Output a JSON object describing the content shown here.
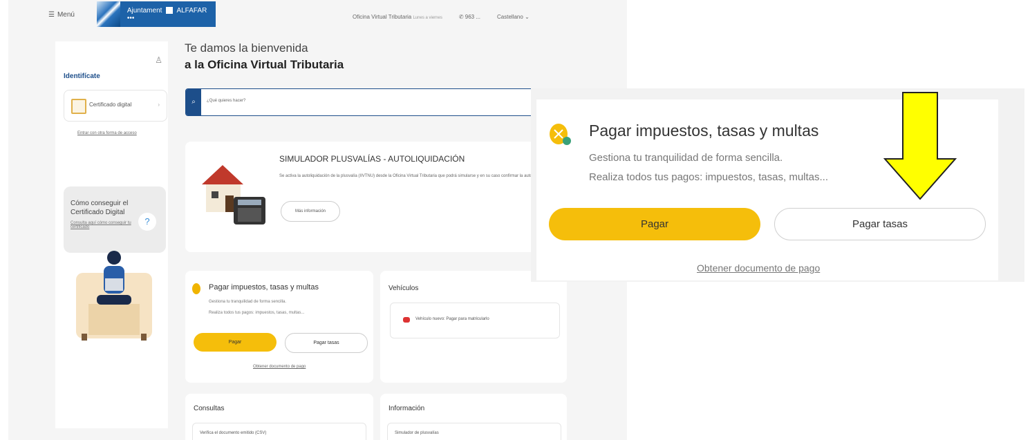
{
  "header": {
    "menu_label": "Menú",
    "brand_name": "Ajuntament",
    "brand_town": "ALFAFAR",
    "brand_dots": "•••",
    "office": "Oficina Virtual Tributaria",
    "hours": "Lunes a viernes",
    "phone": "963 ...",
    "language": "Castellano"
  },
  "sidebar": {
    "identify_title": "Identifícate",
    "cert_label": "Certificado digital",
    "other_access": "Entrar con otra forma de acceso",
    "howto_title": "Cómo conseguir el Certificado Digital",
    "howto_link": "Consulta aquí cómo conseguir tu certificado",
    "help_glyph": "?"
  },
  "welcome": {
    "line1": "Te damos la bienvenida",
    "line2": "a la Oficina Virtual Tributaria"
  },
  "search": {
    "placeholder": "¿Qué quieres hacer?"
  },
  "simulator": {
    "title": "SIMULADOR PLUSVALÍAS - AUTOLIQUIDACIÓN",
    "text": "Se activa la autoliquidación de la plusvalía (IIVTNU) desde la Oficina Virtual Tributaria que podrá simularse y en su caso confirmar la autoliquidación.",
    "button": "Más información"
  },
  "pay_card": {
    "title": "Pagar impuestos, tasas y multas",
    "sub1": "Gestiona tu tranquilidad de forma sencilla.",
    "sub2": "Realiza todos tus pagos: impuestos, tasas, multas...",
    "pay": "Pagar",
    "pay_fees": "Pagar tasas",
    "doc_link": "Obtener documento de pago"
  },
  "vehicles": {
    "title": "Vehículos",
    "item": "Vehículo nuevo: Pagar para matricularlo"
  },
  "queries": {
    "title": "Consultas",
    "item": "Verifica el documento emitido (CSV)"
  },
  "information": {
    "title": "Información",
    "item": "Simulador de plusvalías"
  },
  "zoom": {
    "title": "Pagar impuestos, tasas y multas",
    "sub1": "Gestiona tu tranquilidad de forma sencilla.",
    "sub2": "Realiza todos tus pagos: impuestos, tasas, multas...",
    "pay": "Pagar",
    "pay_fees": "Pagar tasas",
    "doc_link": "Obtener documento de pago"
  },
  "colors": {
    "accent": "#f5be0b",
    "brand": "#1d62a8",
    "arrow": "#ffff00"
  }
}
